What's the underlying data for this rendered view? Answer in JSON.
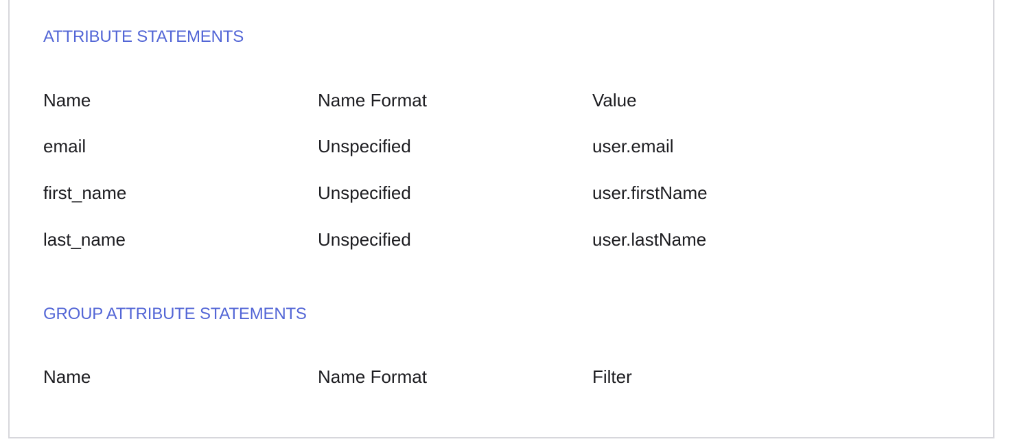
{
  "accent_color": "#5366d6",
  "attribute_statements": {
    "title": "ATTRIBUTE STATEMENTS",
    "headers": [
      "Name",
      "Name Format",
      "Value"
    ],
    "rows": [
      [
        "email",
        "Unspecified",
        "user.email"
      ],
      [
        "first_name",
        "Unspecified",
        "user.firstName"
      ],
      [
        "last_name",
        "Unspecified",
        "user.lastName"
      ]
    ]
  },
  "group_attribute_statements": {
    "title": "GROUP ATTRIBUTE STATEMENTS",
    "headers": [
      "Name",
      "Name Format",
      "Filter"
    ]
  }
}
